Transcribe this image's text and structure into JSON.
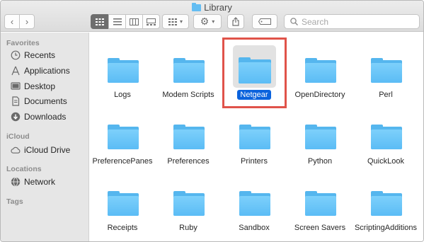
{
  "window": {
    "title": "Library"
  },
  "toolbar": {
    "back_icon": "chevron-left",
    "forward_icon": "chevron-right",
    "view_buttons": [
      "icon-view",
      "list-view",
      "column-view",
      "gallery-view"
    ],
    "group_icon": "group-grid",
    "action_icon": "gear",
    "share_icon": "share",
    "tag_icon": "tag",
    "search_placeholder": "Search"
  },
  "sidebar": {
    "favorites_label": "Favorites",
    "favorites": [
      {
        "label": "Recents",
        "icon": "clock-icon"
      },
      {
        "label": "Applications",
        "icon": "applications-icon"
      },
      {
        "label": "Desktop",
        "icon": "desktop-icon"
      },
      {
        "label": "Documents",
        "icon": "document-icon"
      },
      {
        "label": "Downloads",
        "icon": "download-icon"
      }
    ],
    "icloud_label": "iCloud",
    "icloud": [
      {
        "label": "iCloud Drive",
        "icon": "cloud-icon"
      }
    ],
    "locations_label": "Locations",
    "locations": [
      {
        "label": "Network",
        "icon": "network-icon"
      }
    ],
    "tags_label": "Tags"
  },
  "folders": [
    {
      "label": "Logs",
      "selected": false
    },
    {
      "label": "Modem Scripts",
      "selected": false
    },
    {
      "label": "Netgear",
      "selected": true
    },
    {
      "label": "OpenDirectory",
      "selected": false
    },
    {
      "label": "Perl",
      "selected": false
    },
    {
      "label": "PreferencePanes",
      "selected": false
    },
    {
      "label": "Preferences",
      "selected": false
    },
    {
      "label": "Printers",
      "selected": false
    },
    {
      "label": "Python",
      "selected": false
    },
    {
      "label": "QuickLook",
      "selected": false
    },
    {
      "label": "Receipts",
      "selected": false
    },
    {
      "label": "Ruby",
      "selected": false
    },
    {
      "label": "Sandbox",
      "selected": false
    },
    {
      "label": "Screen Savers",
      "selected": false
    },
    {
      "label": "ScriptingAdditions",
      "selected": false
    }
  ],
  "colors": {
    "folder": "#5bbcf5",
    "selection": "#0b63dd",
    "highlight_box": "#e0534a"
  }
}
